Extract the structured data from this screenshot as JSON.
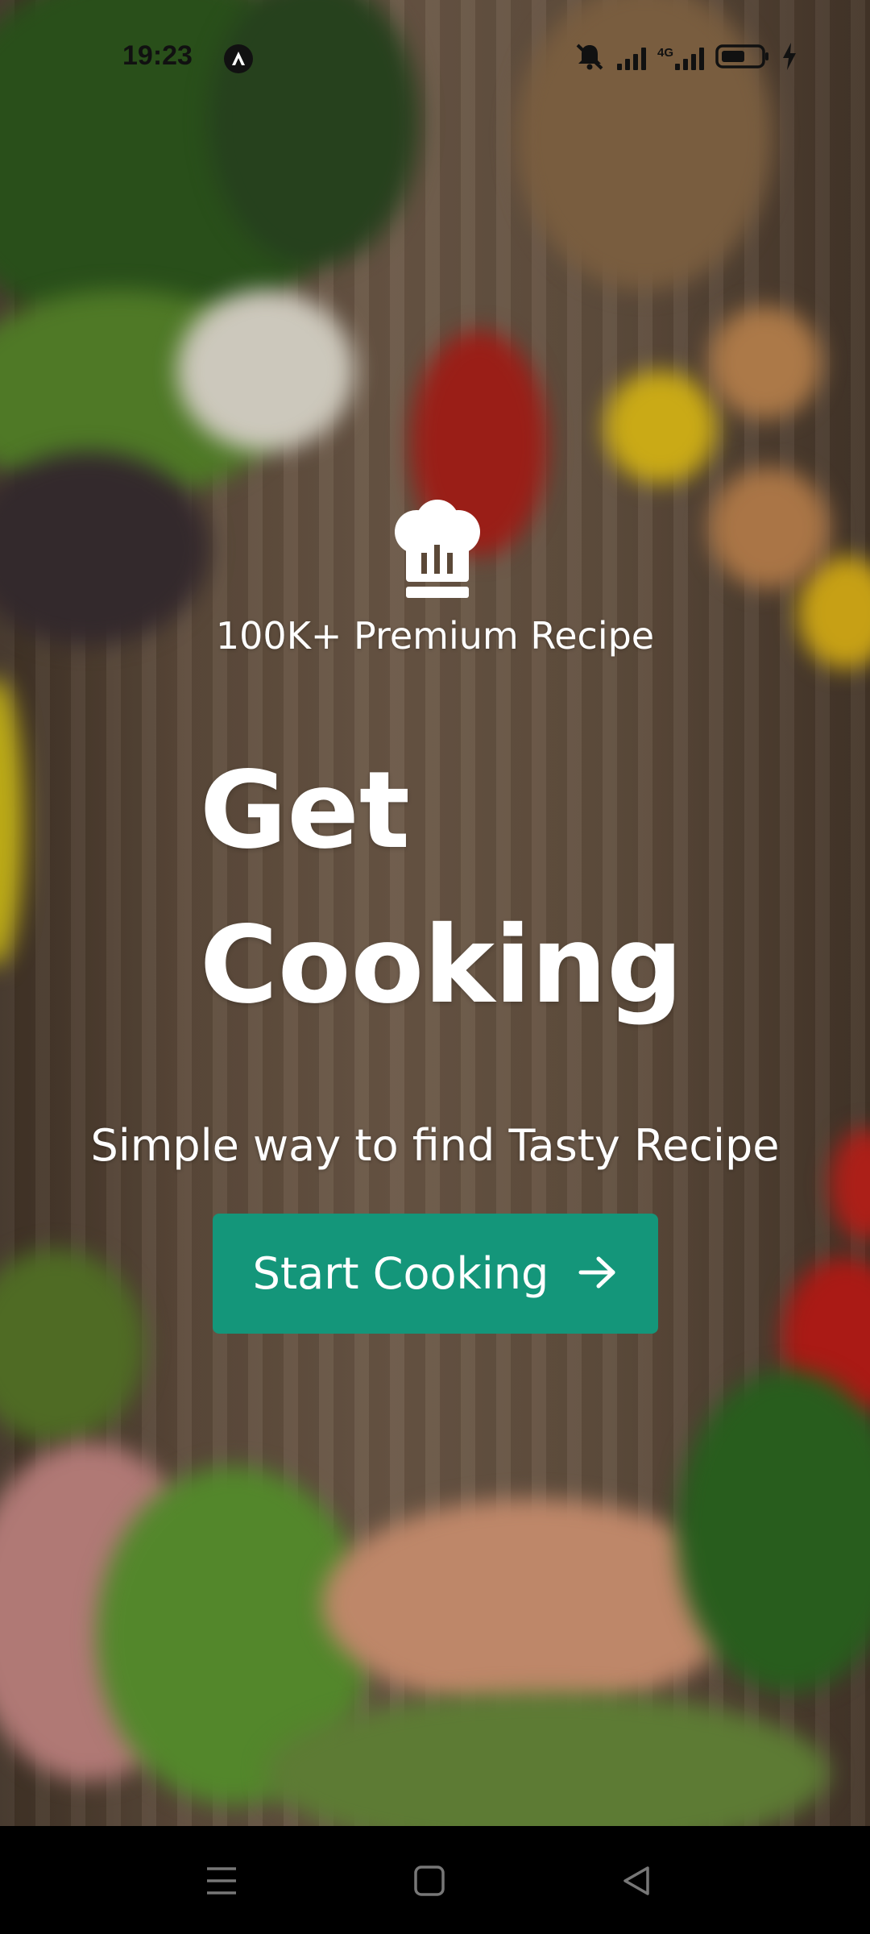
{
  "status_bar": {
    "time": "19:23",
    "network": "4G"
  },
  "hero": {
    "tagline": "100K+ Premium Recipe",
    "headline_line1": "Get",
    "headline_line2": "Cooking",
    "subtitle": "Simple way to find Tasty Recipe"
  },
  "cta": {
    "label": "Start Cooking"
  },
  "colors": {
    "button": "#14967a",
    "text": "#ffffff"
  },
  "icons": [
    "chef-hat-icon",
    "arrow-right-icon",
    "menu-icon",
    "home-icon",
    "back-icon",
    "mute-icon",
    "signal-icon",
    "battery-icon",
    "charging-icon"
  ]
}
